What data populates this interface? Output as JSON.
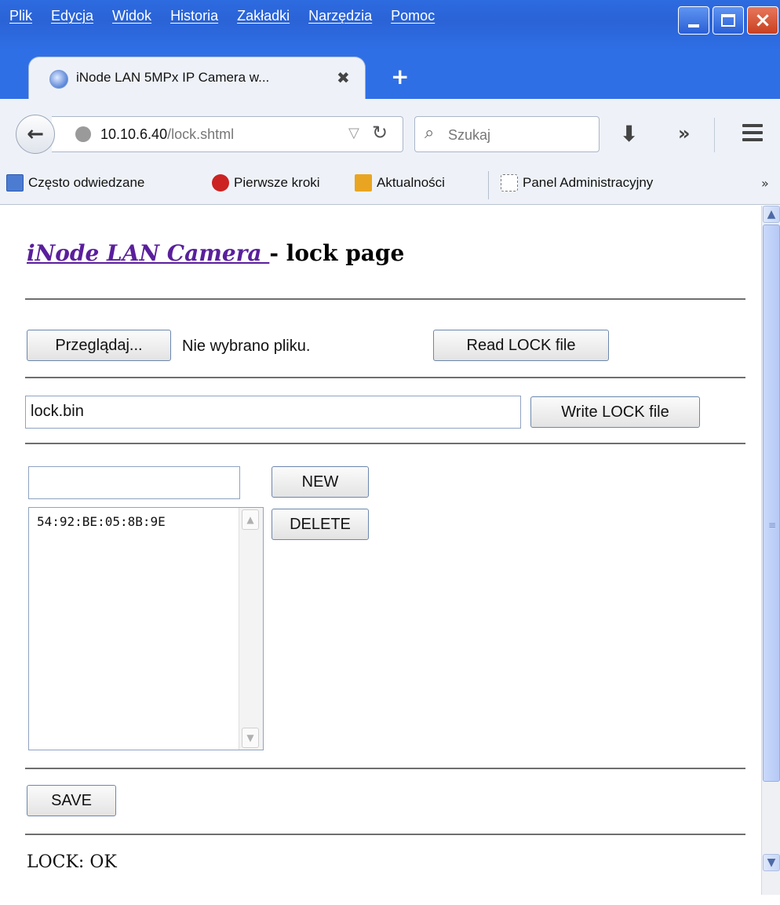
{
  "menu": [
    "Plik",
    "Edycja",
    "Widok",
    "Historia",
    "Zakładki",
    "Narzędzia",
    "Pomoc"
  ],
  "tab": {
    "title": "iNode LAN 5MPx IP Camera w...",
    "close": "✖",
    "new_tab": "+"
  },
  "nav": {
    "url_host": "10.10.6.40",
    "url_path": "/lock.shtml",
    "search_placeholder": "Szukaj",
    "overflow": "»"
  },
  "bookmarks": [
    {
      "label": "Często odwiedzane",
      "icon": "folder-icon"
    },
    {
      "label": "Pierwsze kroki",
      "icon": "mozilla-icon"
    },
    {
      "label": "Aktualności",
      "icon": "rss-icon"
    },
    {
      "label": "Panel Administracyjny",
      "icon": "page-icon"
    }
  ],
  "bookmarks_more": "»",
  "page": {
    "heading_link": "iNode LAN Camera ",
    "heading_rest": "- lock page",
    "browse_button": "Przeglądaj...",
    "no_file": "Nie wybrano pliku.",
    "read_button": "Read LOCK file",
    "write_filename": "lock.bin",
    "write_button": "Write LOCK file",
    "new_entry_value": "",
    "new_button": "NEW",
    "delete_button": "DELETE",
    "list_items": [
      "54:92:BE:05:8B:9E"
    ],
    "save_button": "SAVE",
    "status": "LOCK: OK"
  },
  "colors": {
    "titlebar": "#2a63d6",
    "link": "#5a1f9c",
    "close_button": "#c8401f"
  }
}
